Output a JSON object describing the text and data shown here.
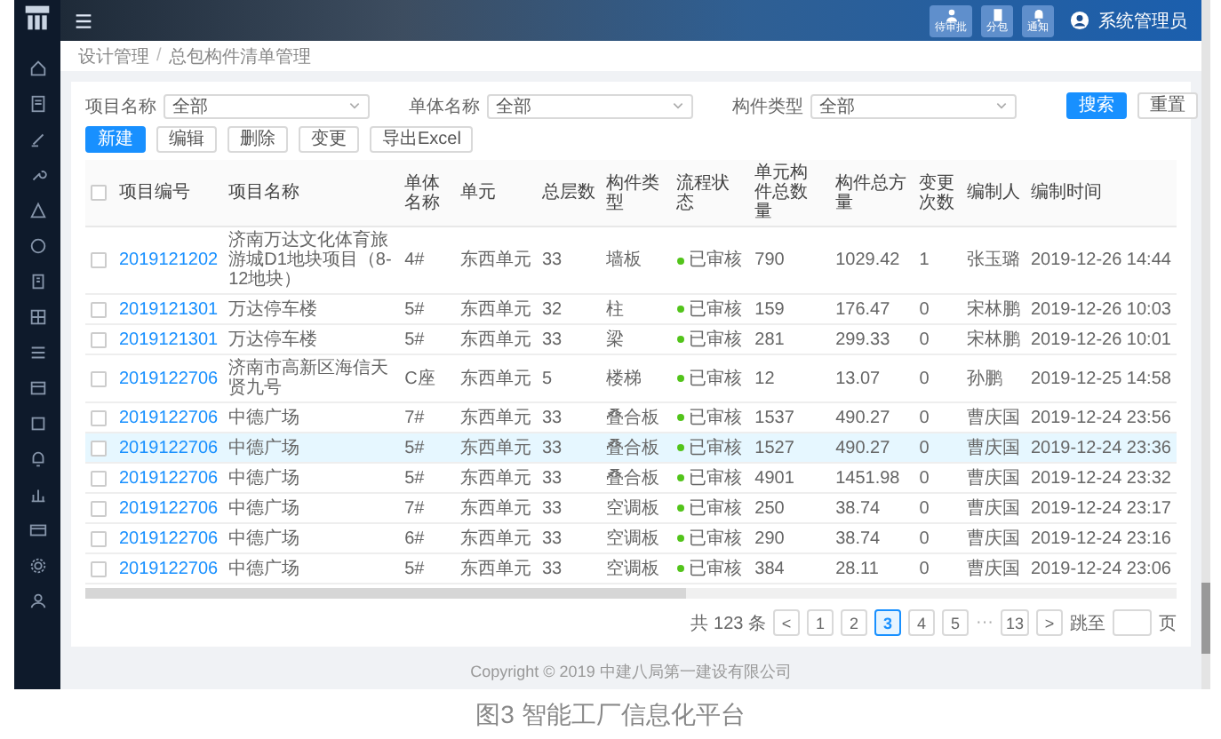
{
  "header": {
    "actions": [
      {
        "label": "待审批",
        "kind": "person"
      },
      {
        "label": "分包",
        "kind": "doc"
      },
      {
        "label": "通知",
        "kind": "bell"
      }
    ],
    "user": "系统管理员"
  },
  "breadcrumb": {
    "items": [
      "设计管理",
      "总包构件清单管理"
    ],
    "separator": "/"
  },
  "filters": [
    {
      "label": "项目名称",
      "value": "全部"
    },
    {
      "label": "单体名称",
      "value": "全部"
    },
    {
      "label": "构件类型",
      "value": "全部"
    }
  ],
  "search_buttons": [
    {
      "label": "搜索",
      "kind": "primary"
    },
    {
      "label": "重置",
      "kind": "default"
    }
  ],
  "toolbar": [
    {
      "label": "新建",
      "kind": "primary"
    },
    {
      "label": "编辑",
      "kind": "default"
    },
    {
      "label": "删除",
      "kind": "default"
    },
    {
      "label": "变更",
      "kind": "default"
    },
    {
      "label": "导出Excel",
      "kind": "default"
    }
  ],
  "table": {
    "all_checked": false,
    "columns": [
      {
        "label": "项目编号",
        "kind": "link"
      },
      {
        "label": "项目名称",
        "kind": "long"
      },
      {
        "label": "单体名称",
        "kind": "text"
      },
      {
        "label": "单元",
        "kind": "text"
      },
      {
        "label": "总层数",
        "kind": "text"
      },
      {
        "label": "构件类型",
        "kind": "text"
      },
      {
        "label": "流程状态",
        "kind": "status"
      },
      {
        "label": "单元构件总数量",
        "kind": "text"
      },
      {
        "label": "构件总方量",
        "kind": "text"
      },
      {
        "label": "变更次数",
        "kind": "text"
      },
      {
        "label": "编制人",
        "kind": "text"
      },
      {
        "label": "编制时间",
        "kind": "text"
      }
    ],
    "rows": [
      {
        "checked": false,
        "selected": false,
        "cells": [
          "2019121202",
          "济南万达文化体育旅游城D1地块项目（8-12地块）",
          "4#",
          "东西单元",
          "33",
          "墙板",
          "已审核",
          "790",
          "1029.42",
          "1",
          "张玉璐",
          "2019-12-26 14:44"
        ]
      },
      {
        "checked": false,
        "selected": false,
        "cells": [
          "2019121301",
          "万达停车楼",
          "5#",
          "东西单元",
          "32",
          "柱",
          "已审核",
          "159",
          "176.47",
          "0",
          "宋林鹏",
          "2019-12-26 10:03"
        ]
      },
      {
        "checked": false,
        "selected": false,
        "cells": [
          "2019121301",
          "万达停车楼",
          "5#",
          "东西单元",
          "33",
          "梁",
          "已审核",
          "281",
          "299.33",
          "0",
          "宋林鹏",
          "2019-12-26 10:01"
        ]
      },
      {
        "checked": false,
        "selected": false,
        "cells": [
          "2019122706",
          "济南市高新区海信天贤九号",
          "C座",
          "东西单元",
          "5",
          "楼梯",
          "已审核",
          "12",
          "13.07",
          "0",
          "孙鹏",
          "2019-12-25 14:58"
        ]
      },
      {
        "checked": false,
        "selected": false,
        "cells": [
          "2019122706",
          "中德广场",
          "7#",
          "东西单元",
          "33",
          "叠合板",
          "已审核",
          "1537",
          "490.27",
          "0",
          "曹庆国",
          "2019-12-24 23:56"
        ]
      },
      {
        "checked": false,
        "selected": true,
        "cells": [
          "2019122706",
          "中德广场",
          "5#",
          "东西单元",
          "33",
          "叠合板",
          "已审核",
          "1527",
          "490.27",
          "0",
          "曹庆国",
          "2019-12-24 23:36"
        ]
      },
      {
        "checked": false,
        "selected": false,
        "cells": [
          "2019122706",
          "中德广场",
          "5#",
          "东西单元",
          "33",
          "叠合板",
          "已审核",
          "4901",
          "1451.98",
          "0",
          "曹庆国",
          "2019-12-24 23:32"
        ]
      },
      {
        "checked": false,
        "selected": false,
        "cells": [
          "2019122706",
          "中德广场",
          "7#",
          "东西单元",
          "33",
          "空调板",
          "已审核",
          "250",
          "38.74",
          "0",
          "曹庆国",
          "2019-12-24 23:17"
        ]
      },
      {
        "checked": false,
        "selected": false,
        "cells": [
          "2019122706",
          "中德广场",
          "6#",
          "东西单元",
          "33",
          "空调板",
          "已审核",
          "290",
          "38.74",
          "0",
          "曹庆国",
          "2019-12-24 23:16"
        ]
      },
      {
        "checked": false,
        "selected": false,
        "cells": [
          "2019122706",
          "中德广场",
          "5#",
          "东西单元",
          "33",
          "空调板",
          "已审核",
          "384",
          "28.11",
          "0",
          "曹庆国",
          "2019-12-24 23:06"
        ]
      }
    ]
  },
  "pagination": {
    "total": "共 123 条",
    "prev": "<",
    "next": ">",
    "pages": [
      {
        "label": "1",
        "kind": "page",
        "selected": false
      },
      {
        "label": "2",
        "kind": "page",
        "selected": false
      },
      {
        "label": "3",
        "kind": "page",
        "selected": true
      },
      {
        "label": "4",
        "kind": "page",
        "selected": false
      },
      {
        "label": "5",
        "kind": "page",
        "selected": false
      },
      {
        "label": "···",
        "kind": "ellipsis"
      },
      {
        "label": "13",
        "kind": "page",
        "selected": false
      }
    ],
    "jump_label": "跳至",
    "jump_suffix": "页"
  },
  "footer": "Copyright © 2019 中建八局第一建设有限公司",
  "caption": "图3 智能工厂信息化平台"
}
